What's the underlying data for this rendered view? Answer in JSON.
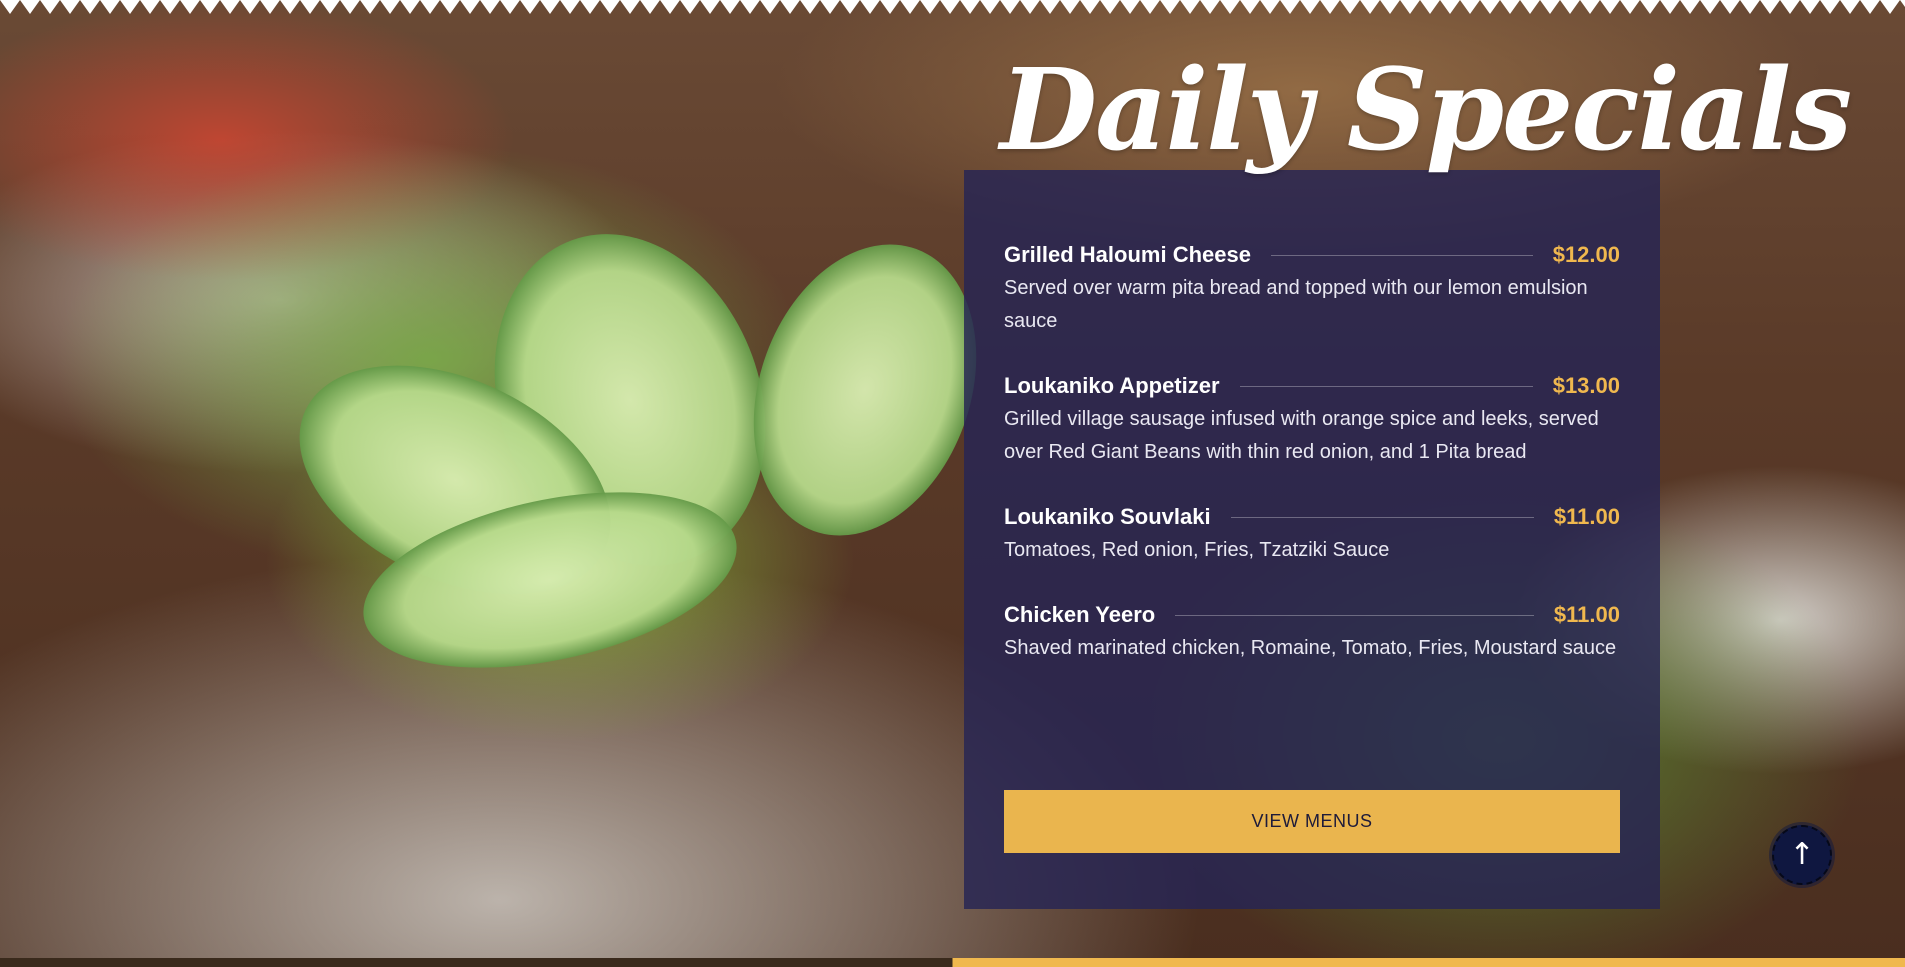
{
  "section": {
    "title": "Daily Specials",
    "background_image": "greek-salad-photo"
  },
  "menu": {
    "items": [
      {
        "name": "Grilled Haloumi Cheese",
        "price": "$12.00",
        "description": "Served over warm pita bread and topped with our lemon emulsion sauce"
      },
      {
        "name": "Loukaniko Appetizer",
        "price": "$13.00",
        "description": "Grilled village sausage infused with orange spice and leeks, served over Red Giant Beans with thin red onion, and 1 Pita bread"
      },
      {
        "name": "Loukaniko Souvlaki",
        "price": "$11.00",
        "description": "Tomatoes, Red onion, Fries, Tzatziki Sauce"
      },
      {
        "name": "Chicken Yeero",
        "price": "$11.00",
        "description": "Shaved marinated chicken, Romaine, Tomato, Fries, Moustard sauce"
      }
    ],
    "button_label": "VIEW MENUS"
  },
  "scroll_top": {
    "icon": "arrow-up-icon",
    "glyph": "↑"
  },
  "colors": {
    "panel": "#262454",
    "accent": "#eab54e",
    "price": "#f0b84e",
    "text": "#ffffff"
  }
}
